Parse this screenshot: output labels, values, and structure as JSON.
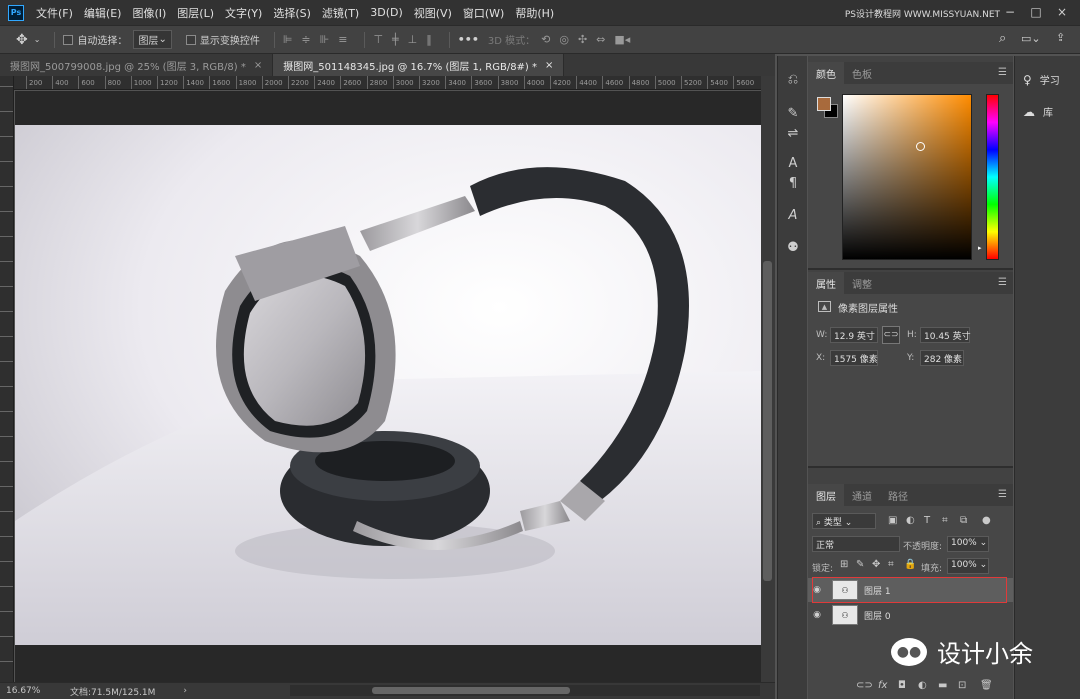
{
  "app": {
    "logo": "Ps",
    "watermark": "PS设计教程网 WWW.MISSYUAN.NET"
  },
  "menu": [
    "文件(F)",
    "编辑(E)",
    "图像(I)",
    "图层(L)",
    "文字(Y)",
    "选择(S)",
    "滤镜(T)",
    "3D(D)",
    "视图(V)",
    "窗口(W)",
    "帮助(H)"
  ],
  "options": {
    "auto_select_label": "自动选择：",
    "auto_select_value": "图层",
    "show_transform_label": "显示变换控件",
    "mode_3d": "3D 模式："
  },
  "tabs": [
    {
      "label": "摄图网_500799008.jpg @ 25% (图层 3, RGB/8) *",
      "close": "×"
    },
    {
      "label": "摄图网_501148345.jpg @ 16.7% (图层 1, RGB/8#) *",
      "close": "×"
    }
  ],
  "ruler_h": [
    "200",
    "400",
    "600",
    "800",
    "1000",
    "1200",
    "1400",
    "1600",
    "1800",
    "2000",
    "2200",
    "2400",
    "2600",
    "2800",
    "3000",
    "3200",
    "3400",
    "3600",
    "3800",
    "4000",
    "4200",
    "4400",
    "4600",
    "4800",
    "5000",
    "5200",
    "5400",
    "5600"
  ],
  "status": {
    "zoom": "16.67%",
    "doc": "文档:71.5M/125.1M"
  },
  "panels": {
    "color": {
      "tabs": [
        "颜色",
        "色板"
      ]
    },
    "properties": {
      "tabs": [
        "属性",
        "调整"
      ],
      "title": "像素图层属性",
      "w_label": "W:",
      "w_value": "12.9 英寸",
      "h_label": "H:",
      "h_value": "10.45 英寸",
      "x_label": "X:",
      "x_value": "1575 像素",
      "y_label": "Y:",
      "y_value": "282 像素"
    },
    "layers": {
      "tabs": [
        "图层",
        "通道",
        "路径"
      ],
      "filter": "类型",
      "blend_mode": "正常",
      "opacity_label": "不透明度:",
      "opacity_value": "100%",
      "lock_label": "锁定:",
      "fill_label": "填充:",
      "fill_value": "100%",
      "items": [
        {
          "name": "图层 1"
        },
        {
          "name": "图层 0"
        }
      ]
    }
  },
  "right_panel": {
    "learn": "学习",
    "library": "库"
  },
  "wechat_mark": "设计小余",
  "colors": {
    "foreground": "#a86a3c",
    "background": "#000000",
    "picker_hue": "#ff8c00",
    "selection_outline": "#e03a3a"
  }
}
